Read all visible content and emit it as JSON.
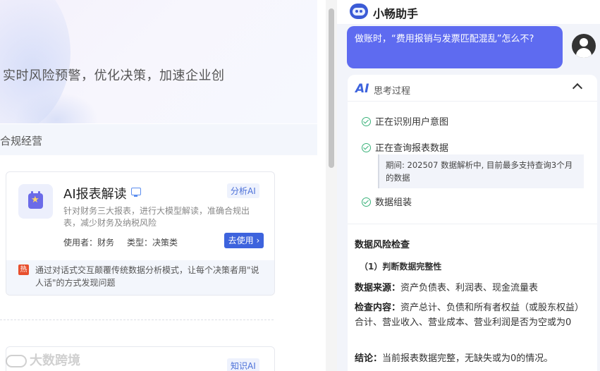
{
  "hero": {
    "text": "实时风险预警，优化决策，加速企业创"
  },
  "section": {
    "title": "合规经营"
  },
  "card": {
    "title": "AI报表解读",
    "tag": "分析AI",
    "desc": "针对财务三大报表，进行大模型解读，准确合规出表，减少财务及纳税风险",
    "user_label": "使用者：财务",
    "type_label": "类型：决策类",
    "use_button": "去使用",
    "hot_label": "热",
    "foot_text": "通过对话式交互颠覆传统数据分析模式，让每个决策者用\"说人话\"的方式发现问题"
  },
  "card2": {
    "tag": "知识AI"
  },
  "watermark": {
    "text": "大数跨境"
  },
  "assistant": {
    "title": "小畅助手",
    "user_message": "做账时，“费用报销与发票匹配混乱”怎么不?",
    "thinking": {
      "title": "思考过程",
      "icon_text": "AI",
      "steps": [
        "正在识别用户意图",
        "正在查询报表数据",
        "数据组装"
      ],
      "note": "期间: 202507 数据解析中, 目前最多支持查询3个月的数据"
    },
    "answer": {
      "title": "数据风险检查",
      "sub": "（1）判断数据完整性",
      "line1_label": "数据来源：",
      "line1_value": "资产负债表、利润表、现金流量表",
      "line2_label": "检查内容：",
      "line2_value": "资产总计、负债和所有者权益（或股东权益）合计、营业收入、营业成本、营业利润是否为空或为0",
      "line3_label": "结论：",
      "line3_value": "当前报表数据完整，无缺失或为0的情况。"
    }
  },
  "icons": [
    "monitor-icon",
    "calendar-star-icon",
    "hot-icon",
    "bot-avatar-icon",
    "user-avatar-icon",
    "ai-icon",
    "chevron-up-icon",
    "check-icon"
  ],
  "colors": {
    "accent": "#3d63dd",
    "bubble": "#5e6bf0",
    "check": "#3ab27a",
    "hot": "#e8502e"
  }
}
